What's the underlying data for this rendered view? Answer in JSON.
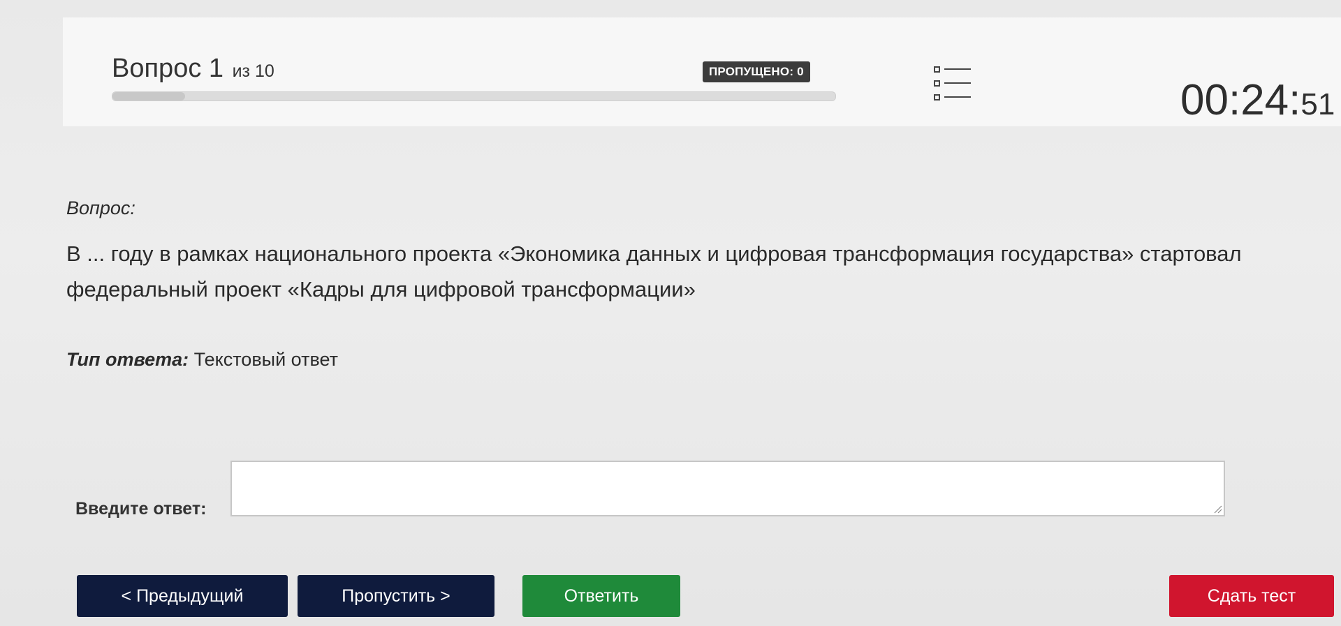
{
  "header": {
    "question_word": "Вопрос 1",
    "question_of": "из 10",
    "progress_fraction": 0.1,
    "skipped_badge": "ПРОПУЩЕНО: 0",
    "list_icon": "list-icon",
    "timer_main": "00:24:",
    "timer_seconds": "51"
  },
  "question": {
    "label": "Вопрос:",
    "text": "В ... году в рамках национального проекта «Экономика данных и цифровая трансформация государства» стартовал федеральный проект «Кадры для цифровой трансформации»"
  },
  "answer_type": {
    "label": "Тип ответа:",
    "value": "Текстовый ответ"
  },
  "answer": {
    "label": "Введите ответ:",
    "value": ""
  },
  "buttons": {
    "prev": "< Предыдущий",
    "skip": "Пропустить >",
    "answer": "Ответить",
    "submit": "Сдать тест"
  },
  "colors": {
    "nav_button": "#0f1b3d",
    "answer_button": "#1f8a3a",
    "submit_button": "#d0152e",
    "badge": "#3c3c3c"
  }
}
